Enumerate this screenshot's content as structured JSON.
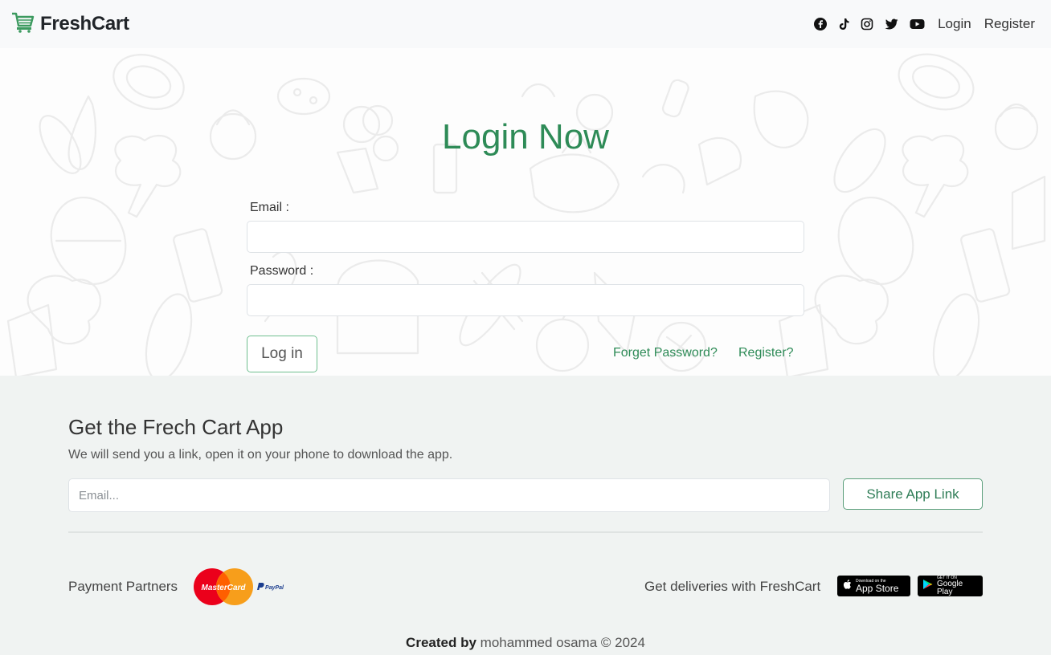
{
  "navbar": {
    "brand": "FreshCart",
    "social_icons": [
      "facebook-icon",
      "tiktok-icon",
      "instagram-icon",
      "twitter-icon",
      "youtube-icon"
    ],
    "login_link": "Login",
    "register_link": "Register"
  },
  "login_form": {
    "title": "Login Now",
    "email_label": "Email :",
    "email_value": "",
    "password_label": "Password :",
    "password_value": "",
    "submit_label": "Log in",
    "forget_password_link": "Forget Password?",
    "register_link": "Register?"
  },
  "footer": {
    "app_title": "Get the Frech Cart App",
    "app_subtitle": "We will send you a link, open it on your phone to download the app.",
    "email_placeholder": "Email...",
    "share_button": "Share App Link",
    "payment_label": "Payment Partners",
    "payment_logos": {
      "mastercard": "MasterCard",
      "paypal": "PayPal"
    },
    "deliveries_label": "Get deliveries with FreshCart",
    "app_store_badge": {
      "small": "Download on the",
      "big": "App Store"
    },
    "google_play_badge": {
      "small": "GET IT ON",
      "big": "Google Play"
    },
    "credit_prefix": "Created by",
    "credit_suffix": "mohammed osama © 2024"
  },
  "colors": {
    "accent": "#2e8b57",
    "navbar_bg": "#f8f9fa",
    "footer_bg": "#f0f3f2"
  }
}
